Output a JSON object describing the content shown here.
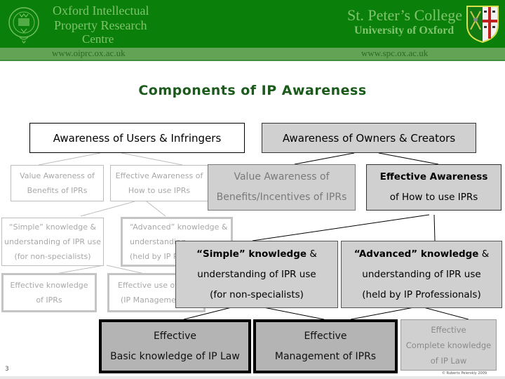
{
  "header": {
    "left_org_lines": [
      "Oxford Intellectual",
      "Property Research",
      "Centre"
    ],
    "left_url": "www.oiprc.ox.ac.uk",
    "right_org_lines": [
      "St. Peter’s College",
      "University of Oxford"
    ],
    "right_url": "www.spc.ox.ac.uk",
    "left_emblem": "oxford-university-crest-icon",
    "right_emblem": "st-peters-college-shield-icon",
    "colors": {
      "header_bg": "#0a7f0a",
      "band_bg": "#63a356",
      "text": "#7fc46e"
    }
  },
  "title": "Components of IP Awareness",
  "diagram": {
    "users_infringers": {
      "label": "Awareness of Users & Infringers",
      "value_awareness": [
        "Value Awareness of",
        "Benefits of IPRs"
      ],
      "effective_awareness": [
        "Effective Awareness of",
        "How to use IPRs"
      ],
      "simple_knowledge": [
        "“Simple” knowledge &",
        "understanding of IPR use",
        "(for non-specialists)"
      ],
      "advanced_knowledge": [
        "“Advanced” knowledge &",
        "understanding",
        "(held by IP P"
      ],
      "effective_knowledge": [
        "Effective knowledge",
        "of IPRs"
      ],
      "effective_use": [
        "Effective use of",
        "(IP Manageme"
      ]
    },
    "owners_creators": {
      "label": "Awareness of Owners & Creators",
      "value_awareness": [
        "Value Awareness of",
        "Benefits/Incentives of IPRs"
      ],
      "effective_awareness": {
        "bold": "Effective Awareness",
        "rest": "of How to use IPRs"
      },
      "simple_knowledge": {
        "bold": "“Simple” knowledge",
        "amp": " &",
        "lines": [
          "understanding of IPR use",
          "(for non-specialists)"
        ]
      },
      "advanced_knowledge": {
        "bold": "“Advanced” knowledge",
        "amp": " &",
        "lines": [
          "understanding of IPR use",
          "(held by IP Professionals)"
        ]
      }
    },
    "outcomes": {
      "basic": [
        "Effective",
        "Basic knowledge of IP Law"
      ],
      "management": [
        "Effective",
        "Management of IPRs"
      ],
      "complete": [
        "Effective",
        "Complete knowledge",
        "of IP Law"
      ]
    }
  },
  "footer": {
    "page_number": "3",
    "copyright": "© Ruberts Pelerskly 2009"
  }
}
